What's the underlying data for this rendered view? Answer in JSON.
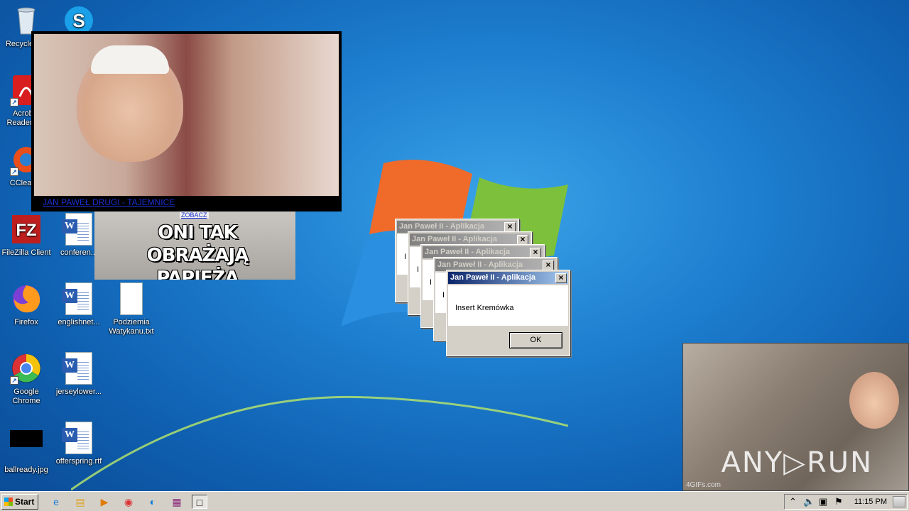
{
  "desktop": {
    "icons": [
      {
        "label": "Recycle Bin",
        "icon": "recycle-bin-icon"
      },
      {
        "label": "Skype",
        "icon": "skype-icon"
      },
      {
        "label": "Acrobat Reader DC",
        "icon": "acrobat-reader-icon"
      },
      {
        "label": "CCleaner",
        "icon": "ccleaner-icon"
      },
      {
        "label": "FileZilla Client",
        "icon": "filezilla-icon"
      },
      {
        "label": "conferen...",
        "icon": "word-doc-icon"
      },
      {
        "label": "Firefox",
        "icon": "firefox-icon"
      },
      {
        "label": "englishnet...",
        "icon": "word-doc-icon"
      },
      {
        "label": "Podziemia Watykanu.txt",
        "icon": "text-file-icon"
      },
      {
        "label": "Google Chrome",
        "icon": "chrome-icon"
      },
      {
        "label": "jerseylower...",
        "icon": "word-doc-icon"
      },
      {
        "label": "ballready.jpg",
        "icon": "image-file-icon"
      },
      {
        "label": "offerspring.rtf",
        "icon": "word-doc-icon"
      }
    ]
  },
  "popups": {
    "video": {
      "link_text": "JAN PAWEŁ DRUGI - TAJEMNICE"
    },
    "meme": {
      "tag": "ZOBACZ",
      "caption_line1": "ONI TAK OBRAŻAJĄ",
      "caption_line2": "PAPIEŻA"
    },
    "gif": {
      "watermark": "ANY▷RUN",
      "source": "4GIFs.com"
    }
  },
  "dialogs": {
    "title": "Jan Paweł II - Aplikacja",
    "message": "Insert Kremówka",
    "ok_label": "OK",
    "partial_text": "I",
    "close_glyph": "×"
  },
  "taskbar": {
    "start_label": "Start",
    "clock": "11:15 PM",
    "quick_launch": [
      "internet-explorer-icon",
      "explorer-icon",
      "media-player-icon",
      "chrome-icon",
      "edge-icon",
      "winrar-icon",
      "window-icon"
    ]
  }
}
